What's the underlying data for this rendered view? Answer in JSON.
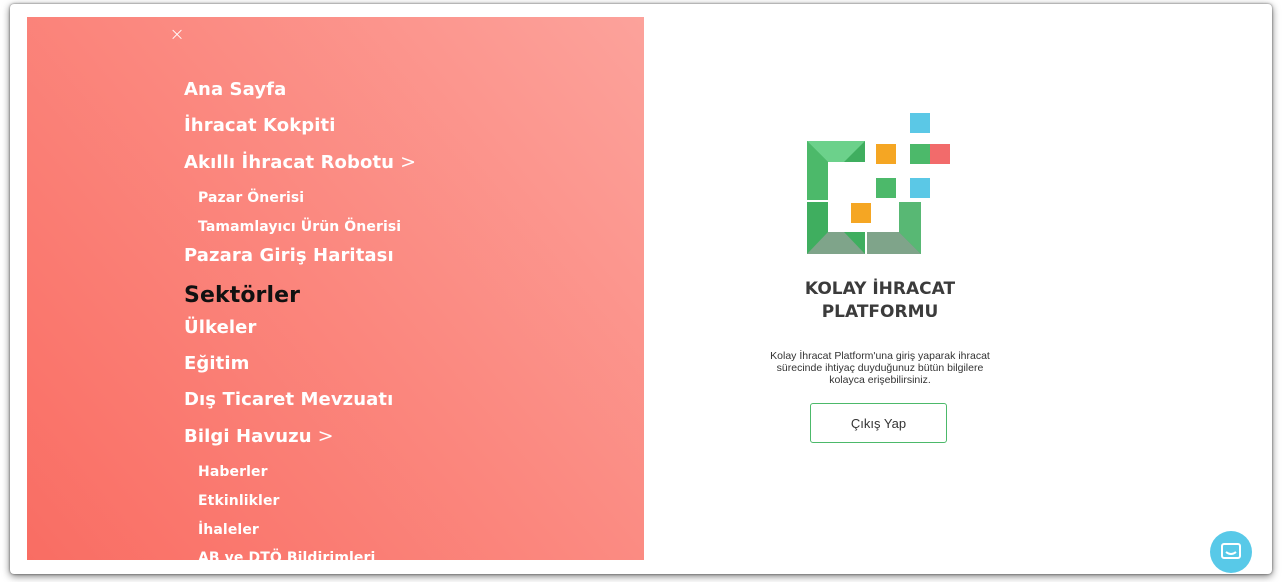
{
  "menu": {
    "close_glyph": "×",
    "items": [
      {
        "label": "Ana Sayfa"
      },
      {
        "label": "İhracat Kokpiti"
      },
      {
        "label": "Akıllı İhracat Robotu"
      },
      {
        "label": "Pazar Önerisi"
      },
      {
        "label": "Tamamlayıcı Ürün Önerisi"
      },
      {
        "label": "Pazara Giriş Haritası"
      },
      {
        "label": "Sektörler"
      },
      {
        "label": "Ülkeler"
      },
      {
        "label": "Eğitim"
      },
      {
        "label": "Dış Ticaret Mevzuatı"
      },
      {
        "label": "Bilgi Havuzu"
      },
      {
        "label": "Haberler"
      },
      {
        "label": "Etkinlikler"
      },
      {
        "label": "İhaleler"
      },
      {
        "label": "AB ve DTÖ Bildirimleri"
      }
    ],
    "chevron_glyph": ">",
    "active_item": "Sektörler"
  },
  "brand": {
    "title_line1": "KOLAY İHRACAT",
    "title_line2": "PLATFORMU",
    "description": "Kolay İhracat Platform'una giriş yaparak ihracat sürecinde ihtiyaç duyduğunuz bütün bilgilere kolayca erişebilirsiniz.",
    "logo_icon": "kolay-ihracat-logo",
    "colors": {
      "green": "#4cb96a",
      "orange": "#f5a623",
      "cyan": "#5bc8e6",
      "red": "#f26b6b"
    }
  },
  "actions": {
    "logout_label": "Çıkış Yap"
  },
  "chat": {
    "icon": "chat-icon"
  }
}
